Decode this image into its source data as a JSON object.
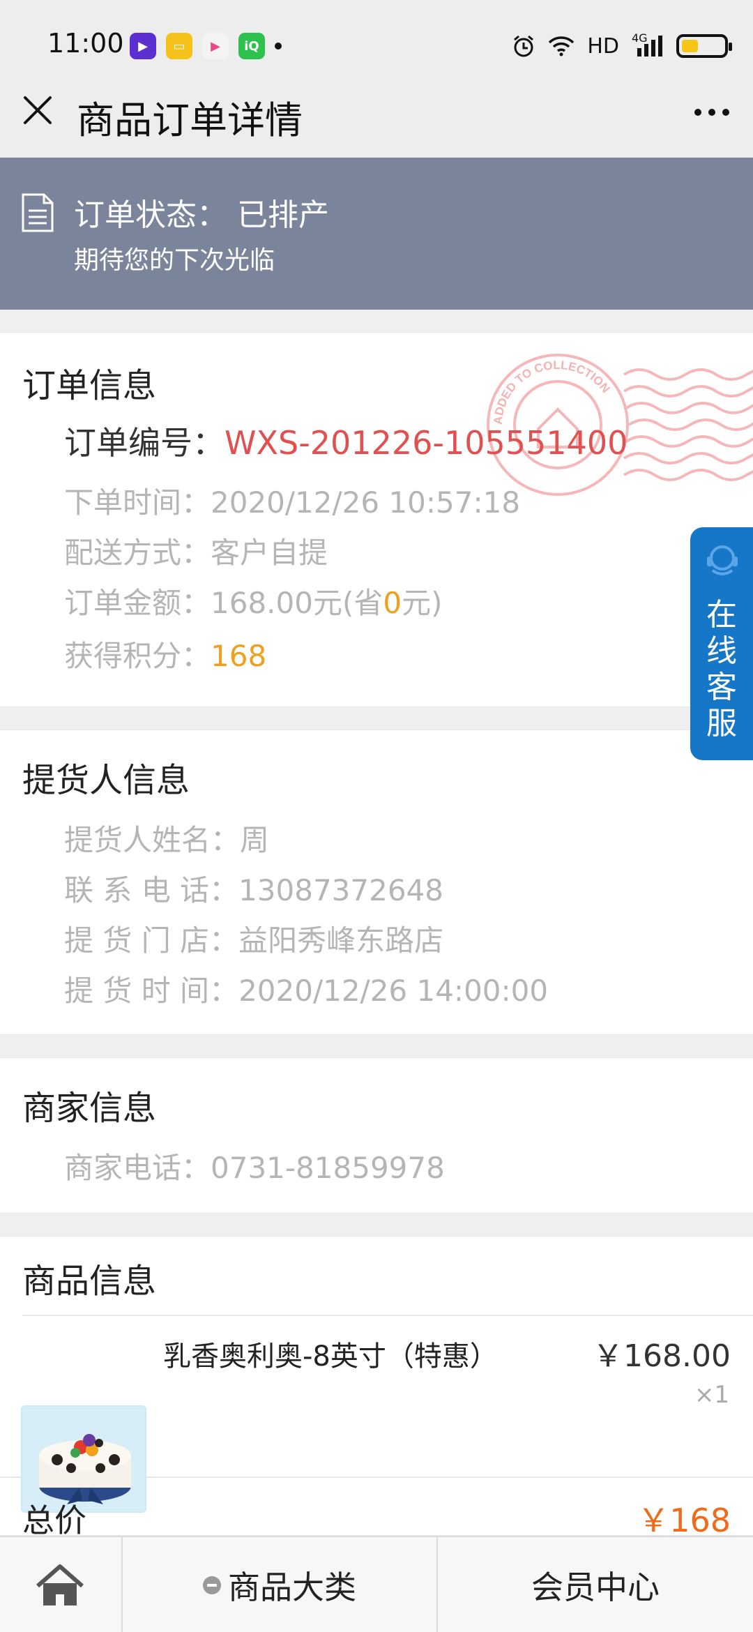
{
  "status_bar": {
    "time": "11:00",
    "network": "HD",
    "signal": "4G",
    "battery_level": 0.4,
    "icons": [
      "video-app-icon",
      "notes-app-icon",
      "player-app-icon",
      "iqiyi-app-icon",
      "notification-dot",
      "alarm-icon",
      "wifi-icon",
      "signal-icon",
      "battery-icon"
    ]
  },
  "nav": {
    "title": "商品订单详情"
  },
  "banner": {
    "status": "订单状态： 已排产",
    "subtitle": "期待您的下次光临"
  },
  "order_info": {
    "title": "订单信息",
    "order_no_label": "订单编号：",
    "order_no": "WXS-201226-105551400",
    "time_label": "下单时间：",
    "time": "2020/12/26 10:57:18",
    "delivery_label": "配送方式：",
    "delivery": "客户自提",
    "amount_label": "订单金额：",
    "amount": "168.00元(省",
    "saved": "0",
    "amount_suffix": "元)",
    "points_label": "获得积分：",
    "points": "168"
  },
  "pickup_info": {
    "title": "提货人信息",
    "name_label": "提货人姓名：",
    "name": "周",
    "phone_label": "联 系 电 话：",
    "phone": "13087372648",
    "store_label": "提 货 门 店：",
    "store": "益阳秀峰东路店",
    "pickup_time_label": "提 货 时 间：",
    "pickup_time": "2020/12/26 14:00:00"
  },
  "merchant_info": {
    "title": "商家信息",
    "phone_label": "商家电话：",
    "phone": "0731-81859978"
  },
  "goods_info": {
    "title": "商品信息",
    "items": [
      {
        "name": "乳香奥利奥-8英寸（特惠）",
        "price": "￥168.00",
        "qty": "×1"
      }
    ]
  },
  "total": {
    "label": "总价",
    "value": "￥168"
  },
  "service_tab": {
    "label": "在线客服"
  },
  "stamp": {
    "text": "ADDED TO COLLECTION"
  },
  "bottom_nav": {
    "category": "商品大类",
    "member": "会员中心"
  },
  "colors": {
    "banner": "#7a859c",
    "order_no": "#e05050",
    "highlight": "#f0a020",
    "total": "#f06a1a",
    "service": "#1677c8"
  }
}
